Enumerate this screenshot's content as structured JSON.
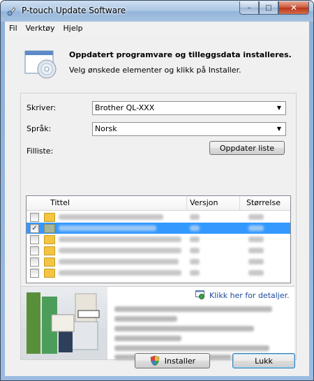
{
  "window": {
    "title": "P-touch Update Software",
    "buttons": {
      "minimize": "–",
      "maximize": "□",
      "close": "✕"
    }
  },
  "menu": [
    "Fil",
    "Verktøy",
    "Hjelp"
  ],
  "header": {
    "title": "Oppdatert programvare og tilleggsdata installeres.",
    "subtitle": "Velg ønskede elementer og klikk på Installer."
  },
  "form": {
    "printer_label": "Skriver:",
    "printer_value": "Brother QL-XXX",
    "language_label": "Språk:",
    "language_value": "Norsk",
    "filelist_label": "Filliste:",
    "update_list_button": "Oppdater liste"
  },
  "file_list": {
    "columns": [
      "Tittel",
      "Versjon",
      "Størrelse"
    ],
    "rows": [
      {
        "checked": false,
        "selected": false,
        "title_width": 150
      },
      {
        "checked": true,
        "selected": true,
        "title_width": 140
      },
      {
        "checked": false,
        "selected": false,
        "title_width": 176
      },
      {
        "checked": false,
        "selected": false,
        "title_width": 176
      },
      {
        "checked": false,
        "selected": false,
        "title_width": 172
      },
      {
        "checked": false,
        "selected": false,
        "title_width": 176
      }
    ]
  },
  "details": {
    "link": "Klikk her for detaljer."
  },
  "footer": {
    "install_button": "Installer",
    "close_button": "Lukk"
  }
}
